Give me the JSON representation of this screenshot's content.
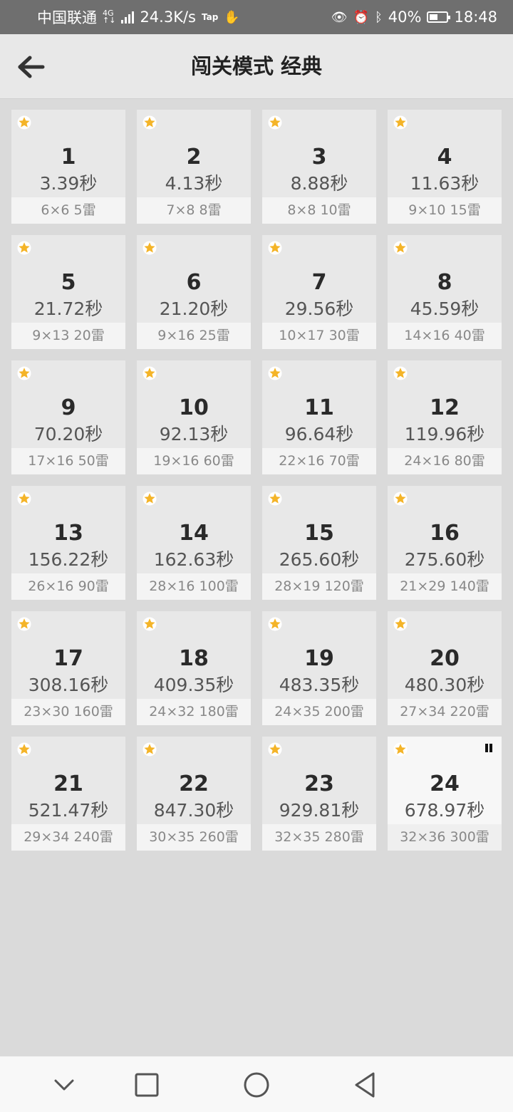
{
  "status_bar": {
    "carrier": "中国联通",
    "net_top": "4G",
    "net_bottom": "↑↓",
    "speed": "24.3K/s",
    "tap_label": "Tap",
    "battery_pct": "40%",
    "time": "18:48"
  },
  "header": {
    "title": "闯关模式 经典"
  },
  "colors": {
    "star": "#f4b428",
    "background": "#dadada",
    "tile": "#e8e8e8"
  },
  "levels": [
    {
      "num": "1",
      "time": "3.39秒",
      "info": "6×6  5雷"
    },
    {
      "num": "2",
      "time": "4.13秒",
      "info": "7×8  8雷"
    },
    {
      "num": "3",
      "time": "8.88秒",
      "info": "8×8  10雷"
    },
    {
      "num": "4",
      "time": "11.63秒",
      "info": "9×10  15雷"
    },
    {
      "num": "5",
      "time": "21.72秒",
      "info": "9×13  20雷"
    },
    {
      "num": "6",
      "time": "21.20秒",
      "info": "9×16  25雷"
    },
    {
      "num": "7",
      "time": "29.56秒",
      "info": "10×17  30雷"
    },
    {
      "num": "8",
      "time": "45.59秒",
      "info": "14×16  40雷"
    },
    {
      "num": "9",
      "time": "70.20秒",
      "info": "17×16  50雷"
    },
    {
      "num": "10",
      "time": "92.13秒",
      "info": "19×16  60雷"
    },
    {
      "num": "11",
      "time": "96.64秒",
      "info": "22×16  70雷"
    },
    {
      "num": "12",
      "time": "119.96秒",
      "info": "24×16  80雷"
    },
    {
      "num": "13",
      "time": "156.22秒",
      "info": "26×16  90雷"
    },
    {
      "num": "14",
      "time": "162.63秒",
      "info": "28×16  100雷"
    },
    {
      "num": "15",
      "time": "265.60秒",
      "info": "28×19  120雷"
    },
    {
      "num": "16",
      "time": "275.60秒",
      "info": "21×29  140雷"
    },
    {
      "num": "17",
      "time": "308.16秒",
      "info": "23×30  160雷"
    },
    {
      "num": "18",
      "time": "409.35秒",
      "info": "24×32  180雷"
    },
    {
      "num": "19",
      "time": "483.35秒",
      "info": "24×35  200雷"
    },
    {
      "num": "20",
      "time": "480.30秒",
      "info": "27×34  220雷"
    },
    {
      "num": "21",
      "time": "521.47秒",
      "info": "29×34  240雷"
    },
    {
      "num": "22",
      "time": "847.30秒",
      "info": "30×35  260雷"
    },
    {
      "num": "23",
      "time": "929.81秒",
      "info": "32×35  280雷"
    },
    {
      "num": "24",
      "time": "678.97秒",
      "info": "32×36  300雷",
      "current": true
    }
  ]
}
